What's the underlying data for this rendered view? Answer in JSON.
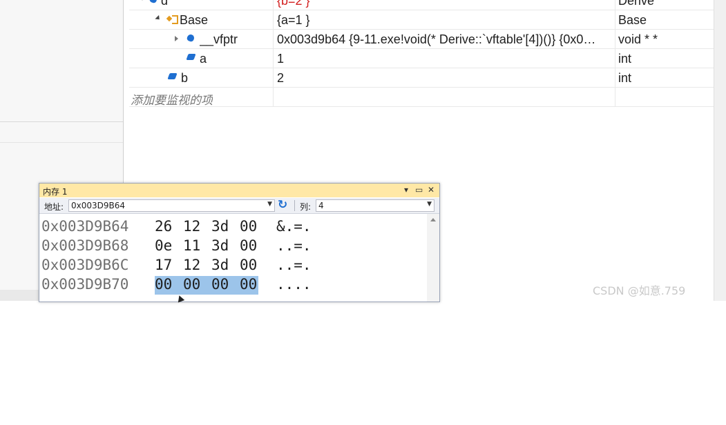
{
  "watch": {
    "rows": [
      {
        "name": "d",
        "value": "{b=2 }",
        "type": "Derive"
      },
      {
        "name": "Base",
        "value": "{a=1 }",
        "type": "Base"
      },
      {
        "name": "__vfptr",
        "value": "0x003d9b64 {9-11.exe!void(* Derive::`vftable'[4])()} {0x0…",
        "type": "void * *"
      },
      {
        "name": "a",
        "value": "1",
        "type": "int"
      },
      {
        "name": "b",
        "value": "2",
        "type": "int"
      }
    ],
    "placeholder": "添加要监视的项"
  },
  "memory": {
    "title": "内存 1",
    "controls": {
      "dropdown": "▾",
      "restore": "▭",
      "close": "✕"
    },
    "address_label": "地址:",
    "address_value": "0x003D9B64",
    "columns_label": "列:",
    "columns_value": "4",
    "rows": [
      {
        "addr": "0x003D9B64",
        "bytes": [
          "26",
          "12",
          "3d",
          "00"
        ],
        "ascii": "&.=."
      },
      {
        "addr": "0x003D9B68",
        "bytes": [
          "0e",
          "11",
          "3d",
          "00"
        ],
        "ascii": "..=."
      },
      {
        "addr": "0x003D9B6C",
        "bytes": [
          "17",
          "12",
          "3d",
          "00"
        ],
        "ascii": "..=."
      },
      {
        "addr": "0x003D9B70",
        "bytes": [
          "00",
          "00",
          "00",
          "00"
        ],
        "ascii": "....",
        "selected": true
      }
    ]
  },
  "watermark": "CSDN @如意.759"
}
